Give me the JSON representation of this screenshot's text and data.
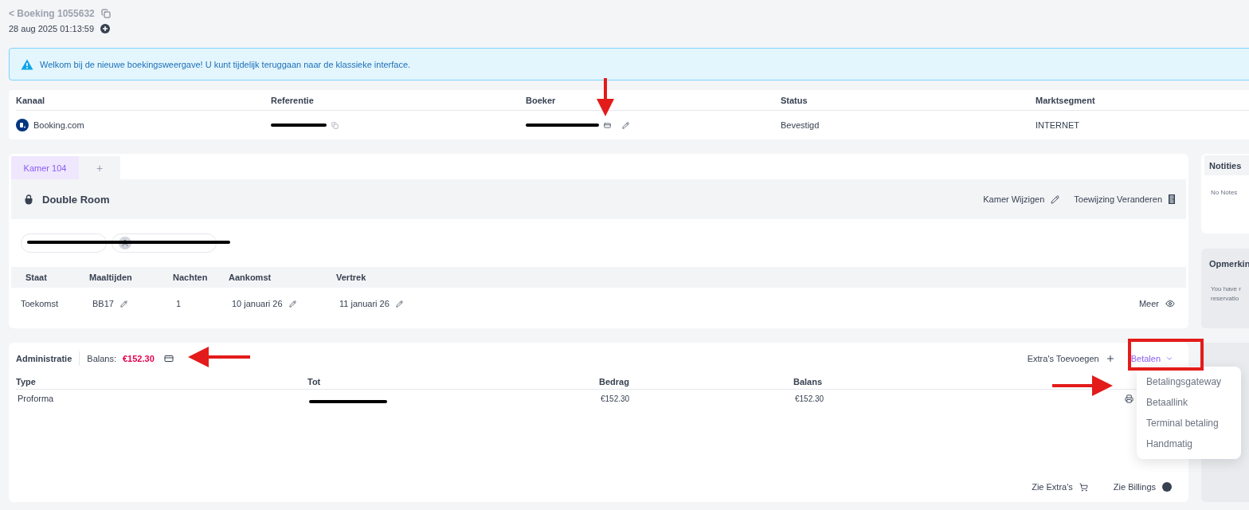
{
  "header": {
    "back_link": "< Boeking 1055632",
    "created": "28 aug 2025 01:13:59"
  },
  "alert": {
    "text": "Welkom bij de nieuwe boekingsweergave! U kunt tijdelijk teruggaan naar de klassieke interface."
  },
  "booking_info": {
    "columns": [
      "Kanaal",
      "Referentie",
      "Boeker",
      "Status",
      "Marktsegment"
    ],
    "cells": [
      {
        "kind": "channel",
        "text": "Booking.com"
      },
      {
        "kind": "redacted_copy"
      },
      {
        "kind": "redacted_edit"
      },
      {
        "kind": "text",
        "text": "Bevestigd"
      },
      {
        "kind": "text",
        "text": "INTERNET"
      }
    ]
  },
  "room": {
    "tabs": [
      {
        "label": "Kamer 104",
        "selected": true
      },
      {
        "label": "+",
        "selected": false
      }
    ],
    "title": "Double Room",
    "actions": [
      {
        "kind": "edit",
        "label": "Kamer Wijzigen"
      },
      {
        "kind": "door",
        "label": "Toewijzing Veranderen"
      }
    ],
    "guests": [
      {
        "kind": "plain"
      },
      {
        "kind": "avatar"
      }
    ],
    "columns": [
      "Staat",
      "Maaltijden",
      "Nachten",
      "Aankomst",
      "Vertrek"
    ],
    "cells": [
      {
        "text": "Toekomst",
        "editable": false
      },
      {
        "text": "BB17",
        "editable": true
      },
      {
        "text": "1",
        "editable": false
      },
      {
        "text": "10 januari 26",
        "editable": true
      },
      {
        "text": "11 januari 26",
        "editable": true
      }
    ],
    "more": "Meer"
  },
  "administration": {
    "title": "Administratie",
    "balance_label": "Balans:",
    "balance": "€152.30",
    "add_extras": "Extra's Toevoegen",
    "pay": "Betalen",
    "pay_menu": [
      "Betalingsgateway",
      "Betaallink",
      "Terminal betaling",
      "Handmatig"
    ],
    "columns": [
      "Type",
      "Tot",
      "Bedrag",
      "Balans"
    ],
    "rows": [
      {
        "type": "Proforma",
        "amount": "€152.30",
        "balance": "€152.30"
      }
    ],
    "footer": [
      {
        "kind": "cart",
        "label": "Zie Extra's"
      },
      {
        "kind": "billing",
        "label": "Zie Billings"
      }
    ]
  },
  "notes": {
    "title": "Notities",
    "text": "No Notes"
  },
  "remarks": {
    "title": "Opmerkin",
    "lines": [
      "You have r",
      "reservatio"
    ]
  }
}
